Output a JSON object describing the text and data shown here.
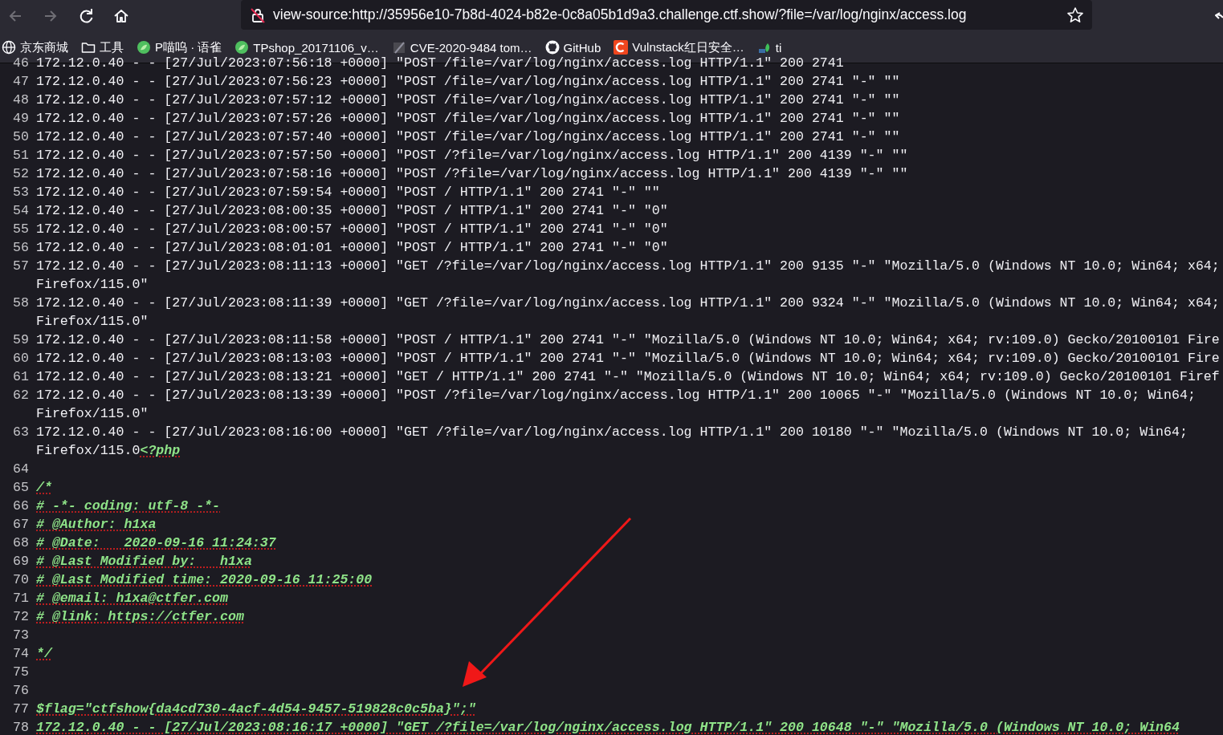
{
  "toolbar": {
    "buttons": [
      {
        "kind": "back",
        "disabled": true
      },
      {
        "kind": "forward",
        "disabled": true
      },
      {
        "kind": "reload",
        "disabled": false
      },
      {
        "kind": "home",
        "disabled": false
      }
    ],
    "url": "view-source:http://35956e10-7b8d-4024-b82e-0c8a05b1d9a3.challenge.ctf.show/?file=/var/log/nginx/access.log"
  },
  "bookmarks": [
    {
      "kind": "globe",
      "label": "京东商城"
    },
    {
      "kind": "folder",
      "label": "工具"
    },
    {
      "kind": "ball",
      "label": "P喵呜 · 语雀"
    },
    {
      "kind": "ball",
      "label": "TPshop_20171106_v…"
    },
    {
      "kind": "slash",
      "label": "CVE-2020-9484 tom…"
    },
    {
      "kind": "cat",
      "label": "GitHub"
    },
    {
      "kind": "letter",
      "label": "Vulnstack红日安全…"
    },
    {
      "kind": "plant",
      "label": "ti"
    }
  ],
  "source_lines": [
    {
      "number": "46",
      "parts": [
        {
          "kind": "plain",
          "text": "172.12.0.40 - - [27/Jul/2023:07:56:18 +0000] \"POST /file=/var/log/nginx/access.log HTTP/1.1\" 200 2741"
        }
      ]
    },
    {
      "number": "47",
      "parts": [
        {
          "kind": "plain",
          "text": "172.12.0.40 - - [27/Jul/2023:07:56:23 +0000] \"POST /file=/var/log/nginx/access.log HTTP/1.1\" 200 2741 \"-\" \"\""
        }
      ]
    },
    {
      "number": "48",
      "parts": [
        {
          "kind": "plain",
          "text": "172.12.0.40 - - [27/Jul/2023:07:57:12 +0000] \"POST /file=/var/log/nginx/access.log HTTP/1.1\" 200 2741 \"-\" \"\""
        }
      ]
    },
    {
      "number": "49",
      "parts": [
        {
          "kind": "plain",
          "text": "172.12.0.40 - - [27/Jul/2023:07:57:26 +0000] \"POST /file=/var/log/nginx/access.log HTTP/1.1\" 200 2741 \"-\" \"\""
        }
      ]
    },
    {
      "number": "50",
      "parts": [
        {
          "kind": "plain",
          "text": "172.12.0.40 - - [27/Jul/2023:07:57:40 +0000] \"POST /file=/var/log/nginx/access.log HTTP/1.1\" 200 2741 \"-\" \"\""
        }
      ]
    },
    {
      "number": "51",
      "parts": [
        {
          "kind": "plain",
          "text": "172.12.0.40 - - [27/Jul/2023:07:57:50 +0000] \"POST /?file=/var/log/nginx/access.log HTTP/1.1\" 200 4139 \"-\" \"\""
        }
      ]
    },
    {
      "number": "52",
      "parts": [
        {
          "kind": "plain",
          "text": "172.12.0.40 - - [27/Jul/2023:07:58:16 +0000] \"POST /?file=/var/log/nginx/access.log HTTP/1.1\" 200 4139 \"-\" \"\""
        }
      ]
    },
    {
      "number": "53",
      "parts": [
        {
          "kind": "plain",
          "text": "172.12.0.40 - - [27/Jul/2023:07:59:54 +0000] \"POST / HTTP/1.1\" 200 2741 \"-\" \"\""
        }
      ]
    },
    {
      "number": "54",
      "parts": [
        {
          "kind": "plain",
          "text": "172.12.0.40 - - [27/Jul/2023:08:00:35 +0000] \"POST / HTTP/1.1\" 200 2741 \"-\" \"0\""
        }
      ]
    },
    {
      "number": "55",
      "parts": [
        {
          "kind": "plain",
          "text": "172.12.0.40 - - [27/Jul/2023:08:00:57 +0000] \"POST / HTTP/1.1\" 200 2741 \"-\" \"0\""
        }
      ]
    },
    {
      "number": "56",
      "parts": [
        {
          "kind": "plain",
          "text": "172.12.0.40 - - [27/Jul/2023:08:01:01 +0000] \"POST / HTTP/1.1\" 200 2741 \"-\" \"0\""
        }
      ]
    },
    {
      "number": "57",
      "parts": [
        {
          "kind": "plain",
          "text": "172.12.0.40 - - [27/Jul/2023:08:11:13 +0000] \"GET /?file=/var/log/nginx/access.log HTTP/1.1\" 200 9135 \"-\" \"Mozilla/5.0 (Windows NT 10.0; Win64; x64;"
        }
      ],
      "continued": [
        {
          "kind": "plain",
          "text": "Firefox/115.0\""
        }
      ]
    },
    {
      "number": "58",
      "parts": [
        {
          "kind": "plain",
          "text": "172.12.0.40 - - [27/Jul/2023:08:11:39 +0000] \"GET /?file=/var/log/nginx/access.log HTTP/1.1\" 200 9324 \"-\" \"Mozilla/5.0 (Windows NT 10.0; Win64; x64;"
        }
      ],
      "continued": [
        {
          "kind": "plain",
          "text": "Firefox/115.0\""
        }
      ]
    },
    {
      "number": "59",
      "parts": [
        {
          "kind": "plain",
          "text": "172.12.0.40 - - [27/Jul/2023:08:11:58 +0000] \"POST / HTTP/1.1\" 200 2741 \"-\" \"Mozilla/5.0 (Windows NT 10.0; Win64; x64; rv:109.0) Gecko/20100101 Fire"
        }
      ]
    },
    {
      "number": "60",
      "parts": [
        {
          "kind": "plain",
          "text": "172.12.0.40 - - [27/Jul/2023:08:13:03 +0000] \"POST / HTTP/1.1\" 200 2741 \"-\" \"Mozilla/5.0 (Windows NT 10.0; Win64; x64; rv:109.0) Gecko/20100101 Fire"
        }
      ]
    },
    {
      "number": "61",
      "parts": [
        {
          "kind": "plain",
          "text": "172.12.0.40 - - [27/Jul/2023:08:13:21 +0000] \"GET / HTTP/1.1\" 200 2741 \"-\" \"Mozilla/5.0 (Windows NT 10.0; Win64; x64; rv:109.0) Gecko/20100101 Firef"
        }
      ]
    },
    {
      "number": "62",
      "parts": [
        {
          "kind": "plain",
          "text": "172.12.0.40 - - [27/Jul/2023:08:13:39 +0000] \"POST /?file=/var/log/nginx/access.log HTTP/1.1\" 200 10065 \"-\" \"Mozilla/5.0 (Windows NT 10.0; Win64;"
        }
      ],
      "continued": [
        {
          "kind": "plain",
          "text": "Firefox/115.0\""
        }
      ]
    },
    {
      "number": "63",
      "parts": [
        {
          "kind": "plain",
          "text": "172.12.0.40 - - [27/Jul/2023:08:16:00 +0000] \"GET /?file=/var/log/nginx/access.log HTTP/1.1\" 200 10180 \"-\" \"Mozilla/5.0 (Windows NT 10.0; Win64;"
        }
      ],
      "continued": [
        {
          "kind": "plain",
          "text": "Firefox/115.0"
        },
        {
          "kind": "error",
          "text": "<?php"
        }
      ]
    },
    {
      "number": "64"
    },
    {
      "number": "65",
      "parts": [
        {
          "kind": "error",
          "text": "/*"
        }
      ]
    },
    {
      "number": "66",
      "parts": [
        {
          "kind": "error",
          "text": "# -*- coding: utf-8 -*-"
        }
      ]
    },
    {
      "number": "67",
      "parts": [
        {
          "kind": "error",
          "text": "# @Author: h1xa"
        }
      ]
    },
    {
      "number": "68",
      "parts": [
        {
          "kind": "error",
          "text": "# @Date:   2020-09-16 11:24:37"
        }
      ]
    },
    {
      "number": "69",
      "parts": [
        {
          "kind": "error",
          "text": "# @Last Modified by:   h1xa"
        }
      ]
    },
    {
      "number": "70",
      "parts": [
        {
          "kind": "error",
          "text": "# @Last Modified time: 2020-09-16 11:25:00"
        }
      ]
    },
    {
      "number": "71",
      "parts": [
        {
          "kind": "error",
          "text": "# @email: h1xa@ctfer.com"
        }
      ]
    },
    {
      "number": "72",
      "parts": [
        {
          "kind": "error",
          "text": "# @link: https://ctfer.com"
        }
      ]
    },
    {
      "number": "73"
    },
    {
      "number": "74",
      "parts": [
        {
          "kind": "error",
          "text": "*/"
        }
      ]
    },
    {
      "number": "75"
    },
    {
      "number": "76"
    },
    {
      "number": "77",
      "parts": [
        {
          "kind": "error",
          "text": "$flag=\"ctfshow{da4cd730-4acf-4d54-9457-519828c0c5ba}\";\""
        }
      ]
    },
    {
      "number": "78",
      "parts": [
        {
          "kind": "error",
          "text": "172.12.0.40 - - [27/Jul/2023:08:16:17 +0000] \"GET /?file=/var/log/nginx/access.log HTTP/1.1\" 200 10648 \"-\" \"Mozilla/5.0 (Windows NT 10.0; Win64"
        }
      ]
    }
  ]
}
